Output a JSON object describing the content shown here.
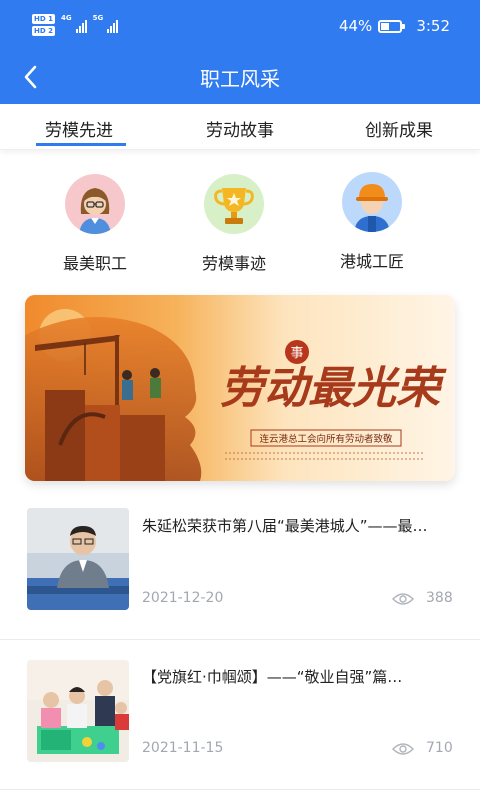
{
  "status_bar": {
    "battery": "44%",
    "battery_level": 0.44,
    "time": "3:52",
    "hd1": "HD 1",
    "hd2": "HD 2",
    "net1": "4G",
    "net2": "5G"
  },
  "navbar": {
    "title": "职工风采",
    "back_icon": "chevron-left-icon"
  },
  "tabs": [
    {
      "label": "劳模先进",
      "active": true
    },
    {
      "label": "劳动故事",
      "active": false
    },
    {
      "label": "创新成果",
      "active": false
    }
  ],
  "categories": [
    {
      "label": "最美职工",
      "icon": "female-worker-avatar-icon",
      "color": "#f7c8cb"
    },
    {
      "label": "劳模事迹",
      "icon": "trophy-icon",
      "color": "#d7f0c8"
    },
    {
      "label": "港城工匠",
      "icon": "hardhat-worker-avatar-icon",
      "color": "#bcd9fb"
    }
  ],
  "banner": {
    "headline": "劳动最光荣",
    "badge": "事",
    "subtitle": "连云港总工会向所有劳动者致敬"
  },
  "news": [
    {
      "headline": "朱延松荣获市第八届“最美港城人”——最…",
      "date": "2021-12-20",
      "views": "388"
    },
    {
      "headline": "【党旗红·巾帼颂】——“敬业自强”篇…",
      "date": "2021-11-15",
      "views": "710"
    }
  ],
  "colors": {
    "primary": "#2f7bef",
    "text": "#222222",
    "muted": "#a3a8b0",
    "banner_orange": "#f29a3a",
    "banner_red": "#a83a1c"
  }
}
